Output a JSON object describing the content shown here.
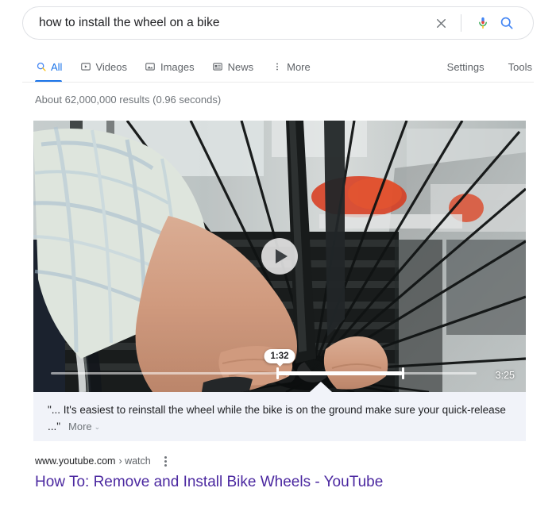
{
  "search": {
    "query": "how to install the wheel on a bike",
    "placeholder": "Search",
    "clear_label": "Clear",
    "voice_label": "Search by voice",
    "submit_label": "Google Search"
  },
  "tabs": [
    {
      "label": "All",
      "icon": "search-icon",
      "active": true
    },
    {
      "label": "Videos",
      "icon": "video-icon",
      "active": false
    },
    {
      "label": "Images",
      "icon": "image-icon",
      "active": false
    },
    {
      "label": "News",
      "icon": "news-icon",
      "active": false
    },
    {
      "label": "More",
      "icon": "kebab-icon",
      "active": false
    }
  ],
  "toolbar": {
    "settings_label": "Settings",
    "tools_label": "Tools"
  },
  "result_stats": "About 62,000,000 results (0.96 seconds)",
  "video": {
    "current_time": "1:32",
    "total_time": "3:25",
    "play_label": "Play",
    "segment_start_pct": 53.0,
    "segment_end_pct": 82.5,
    "alt": "Hands installing a wheel onto a bicycle with spokes and workshop background"
  },
  "caption": {
    "text": "\"... It's easiest to reinstall the wheel while the bike is on the ground make sure your quick-release ...\"",
    "more_label": "More",
    "chevron": "⌄"
  },
  "result": {
    "domain": "www.youtube.com",
    "path": "› watch",
    "title": "How To: Remove and Install Bike Wheels - YouTube",
    "menu_label": "About this result"
  },
  "colors": {
    "google_blue": "#1a73e8",
    "visited_purple": "#4b28a0",
    "caption_bg": "#f1f3f9",
    "muted_text": "#70757a"
  }
}
